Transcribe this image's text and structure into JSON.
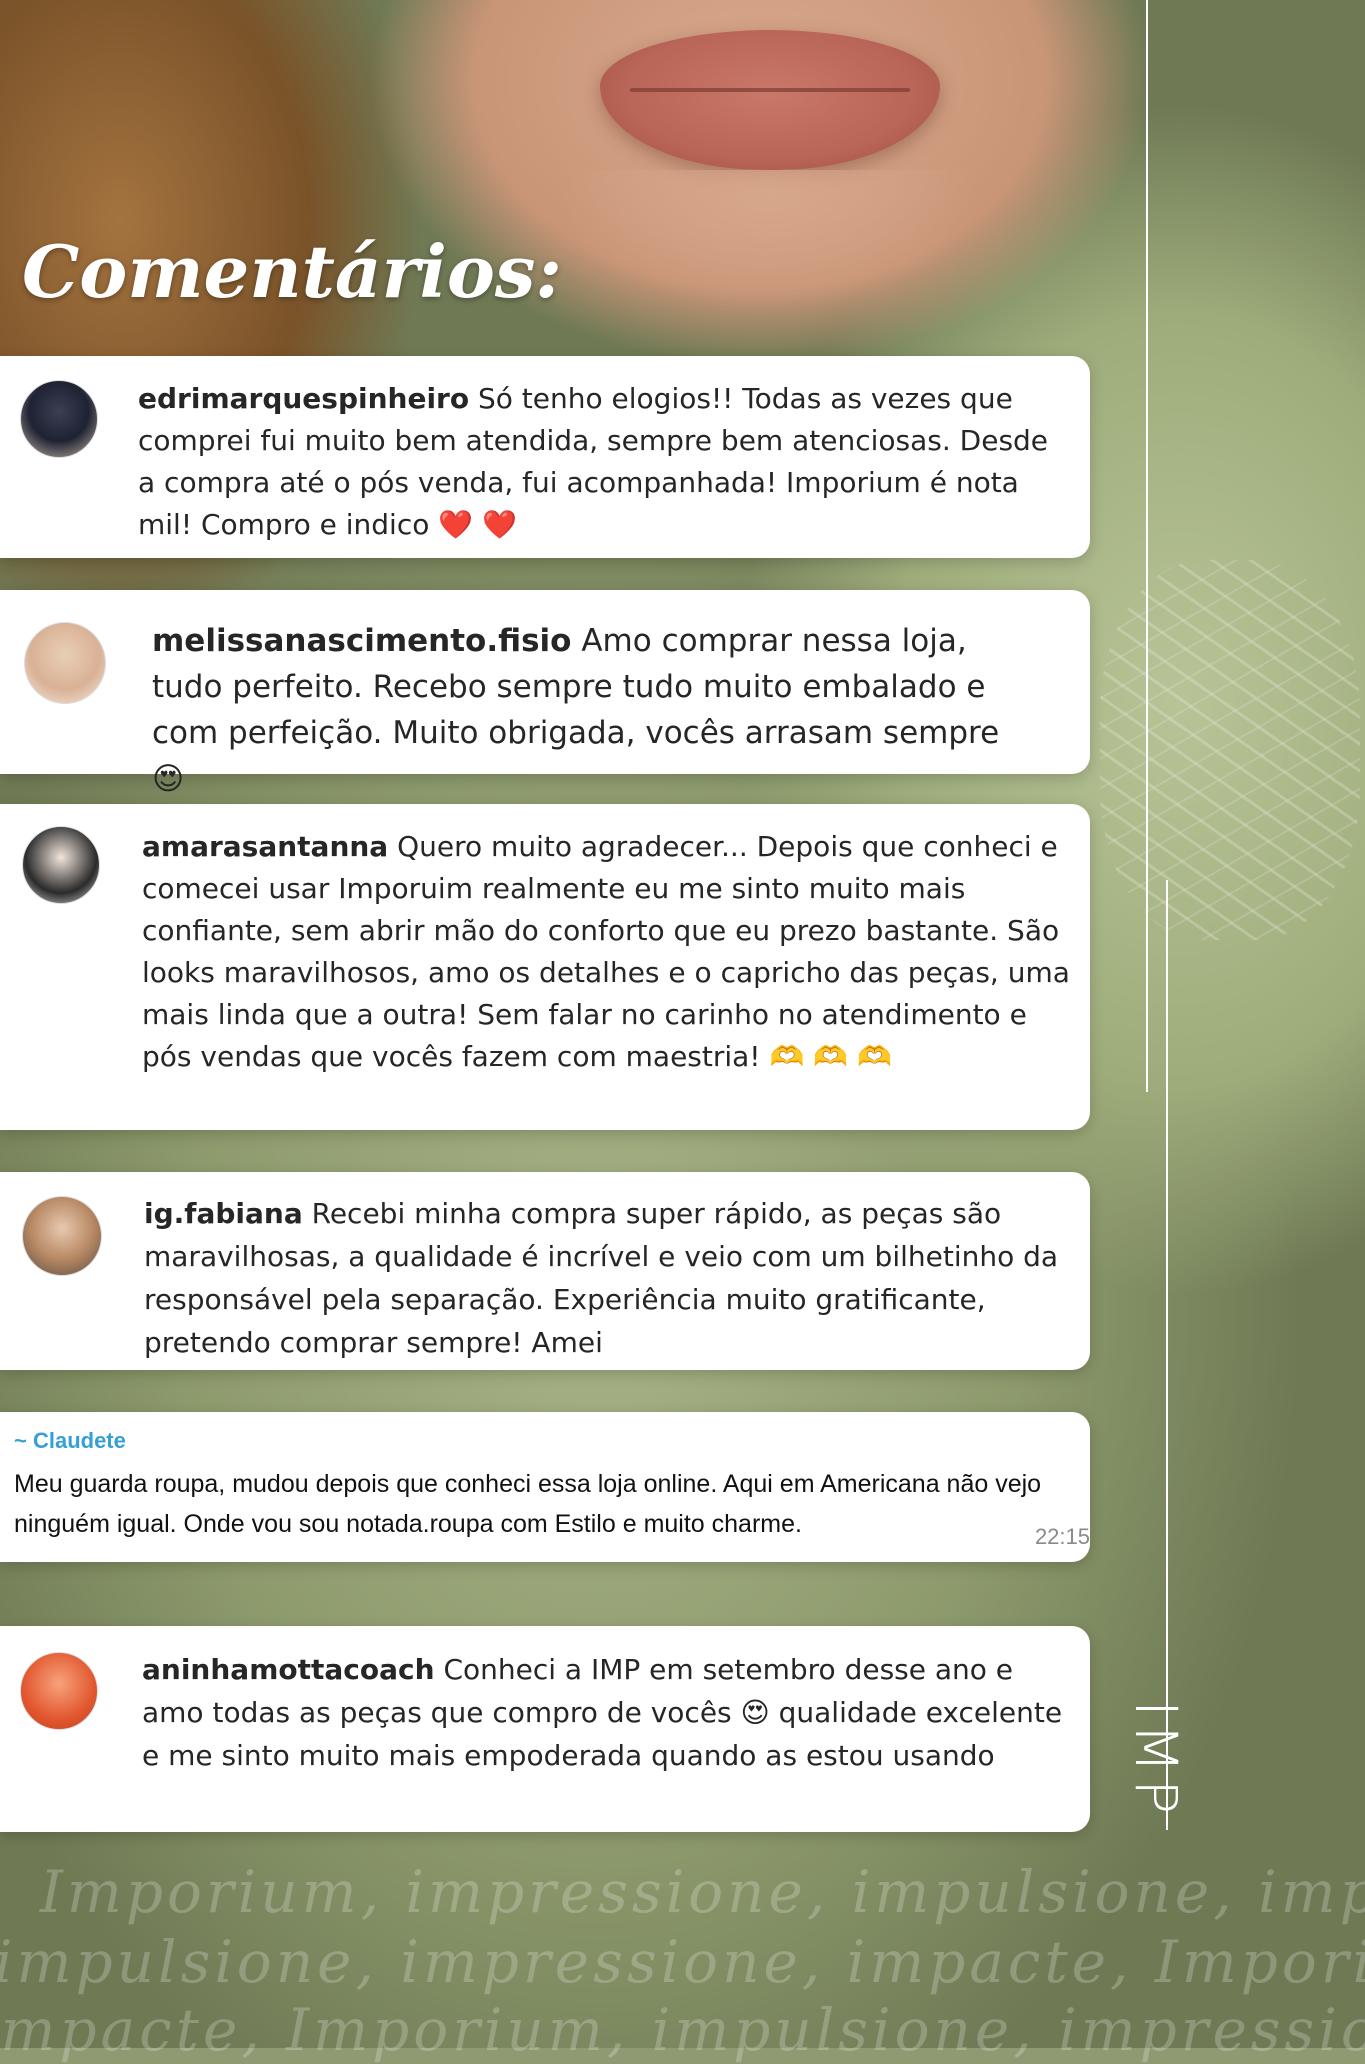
{
  "heading": "Comentários:",
  "brand": "IMP",
  "comments": [
    {
      "user": "edrimarquespinheiro",
      "text": "Só tenho elogios!! Todas as vezes que comprei fui muito bem atendida, sempre bem atenciosas. Desde a compra até o pós venda, fui acompanhada! Imporium é nota mil! Compro e indico",
      "emoji": "❤️ ❤️"
    },
    {
      "user": "melissanascimento.fisio",
      "text": "Amo comprar nessa loja, tudo perfeito. Recebo sempre tudo muito embalado e com perfeição. Muito obrigada, vocês arrasam sempre",
      "emoji": "😍"
    },
    {
      "user": "amarasantanna",
      "text": "Quero muito agradecer... Depois que conheci e comecei usar Imporuim realmente eu me sinto muito mais confiante, sem abrir mão do conforto que eu prezo bastante. São looks maravilhosos, amo os detalhes e o capricho das peças, uma mais linda que a outra! Sem falar no carinho no atendimento e pós vendas que vocês fazem com maestria!",
      "emoji": "🫶 🫶 🫶"
    },
    {
      "user": "ig.fabiana",
      "text": "Recebi minha compra super rápido, as peças são maravilhosas, a qualidade é incrível e veio com um bilhetinho da responsável pela separação. Experiência muito gratificante, pretendo comprar sempre! Amei",
      "emoji": ""
    },
    {
      "user": "aninhamottacoach",
      "text": "Conheci a IMP em setembro desse ano e amo todas as peças que compro de vocês 😍 qualidade excelente e me sinto muito mais empoderada quando as estou usando",
      "emoji": "😍"
    }
  ],
  "whatsapp": {
    "name": "~ Claudete",
    "text": "Meu guarda roupa, mudou depois que conheci essa loja online. Aqui em Americana não vejo ninguém igual. Onde vou sou notada.roupa com Estilo e muito charme.",
    "time": "22:15"
  },
  "watermark": [
    "Imporium, impressione, impulsione, impacte,",
    "impulsione, impressione, impacte, Imporium,",
    "impacte, Imporium, impulsione, impressione, I"
  ]
}
